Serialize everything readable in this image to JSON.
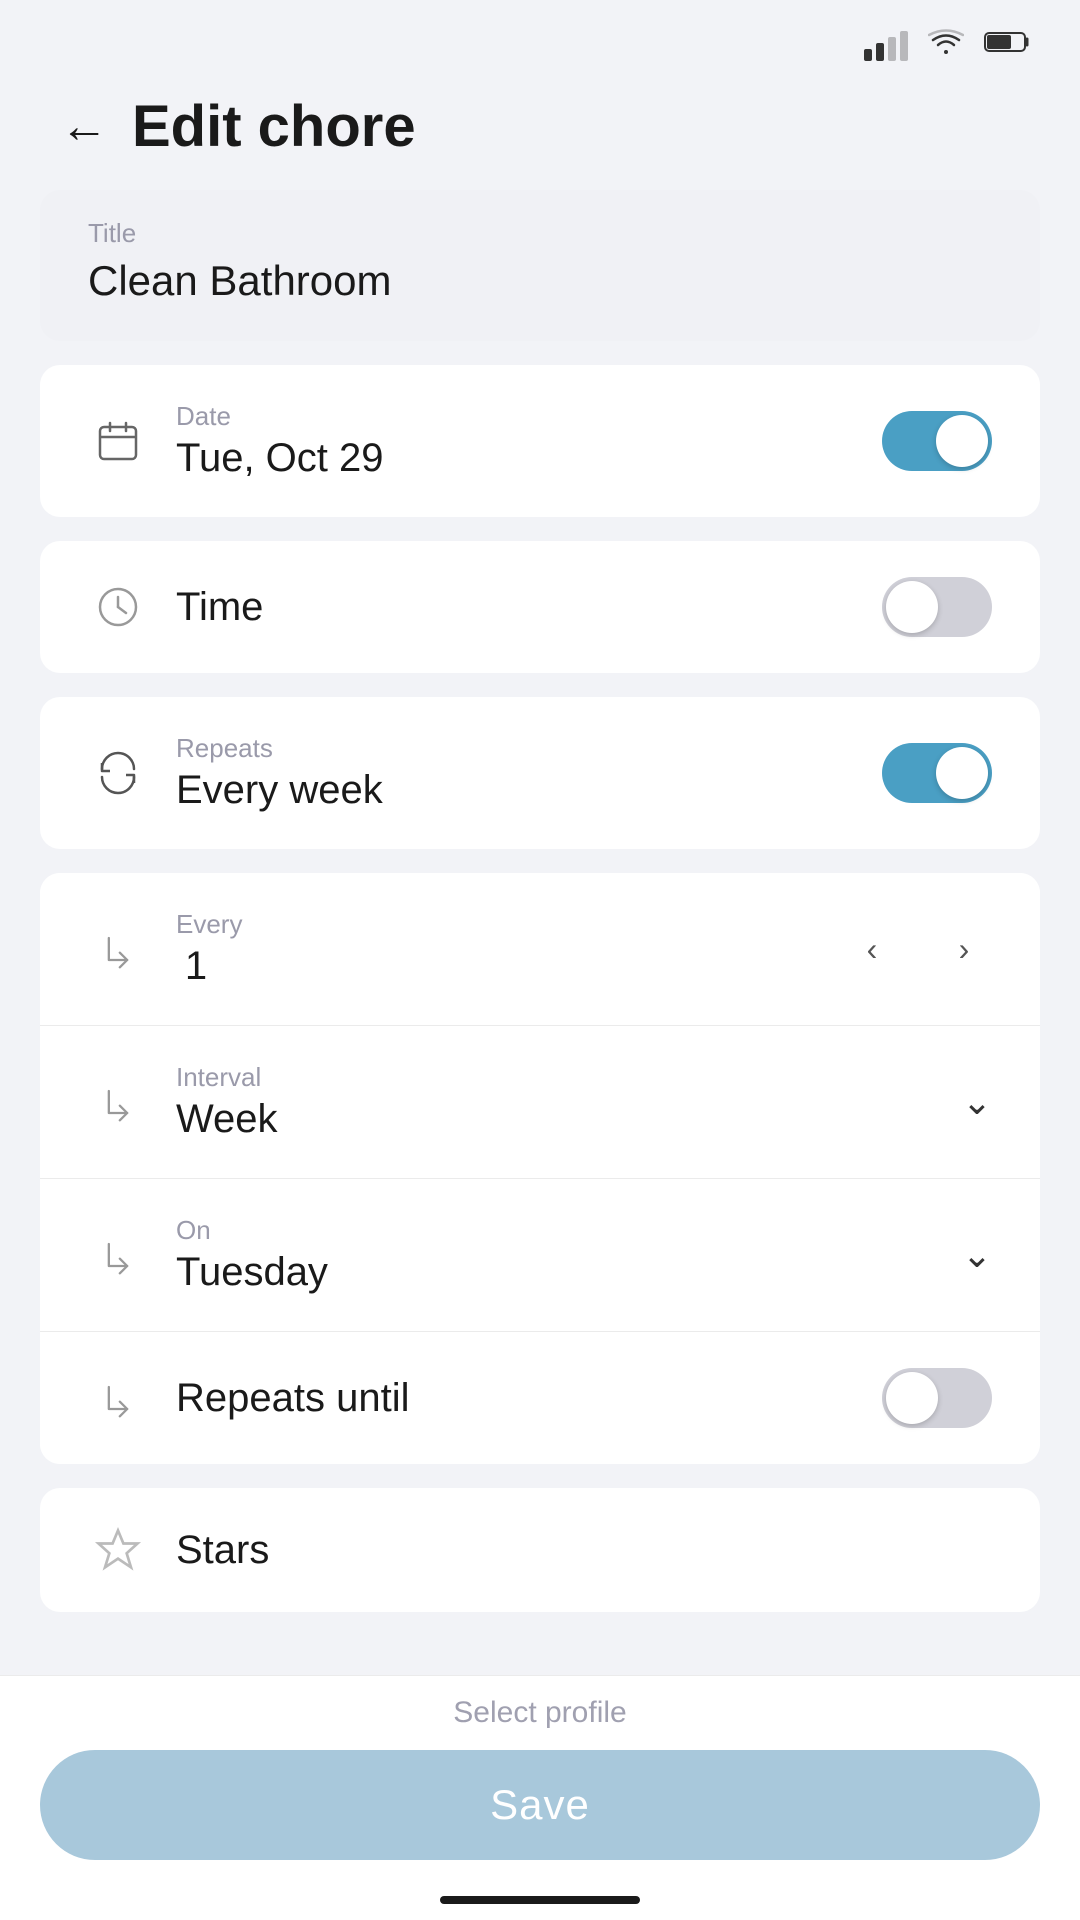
{
  "statusBar": {
    "signalBars": 2,
    "battery": 60
  },
  "header": {
    "backLabel": "←",
    "title": "Edit chore"
  },
  "titleField": {
    "label": "Title",
    "value": "Clean Bathroom"
  },
  "rows": {
    "date": {
      "label": "Date",
      "value": "Tue, Oct 29",
      "toggleOn": true
    },
    "time": {
      "label": "Time",
      "value": "",
      "toggleOn": false
    },
    "repeats": {
      "label": "Repeats",
      "value": "Every week",
      "toggleOn": true
    },
    "every": {
      "label": "Every",
      "value": "1"
    },
    "interval": {
      "label": "Interval",
      "value": "Week"
    },
    "on": {
      "label": "On",
      "value": "Tuesday"
    },
    "repeatsUntil": {
      "label": "Repeats until",
      "toggleOn": false
    },
    "stars": {
      "label": "Stars"
    }
  },
  "bottom": {
    "selectProfileLabel": "Select profile",
    "saveLabel": "Save"
  },
  "stepper": {
    "prevIcon": "‹",
    "nextIcon": "›"
  }
}
